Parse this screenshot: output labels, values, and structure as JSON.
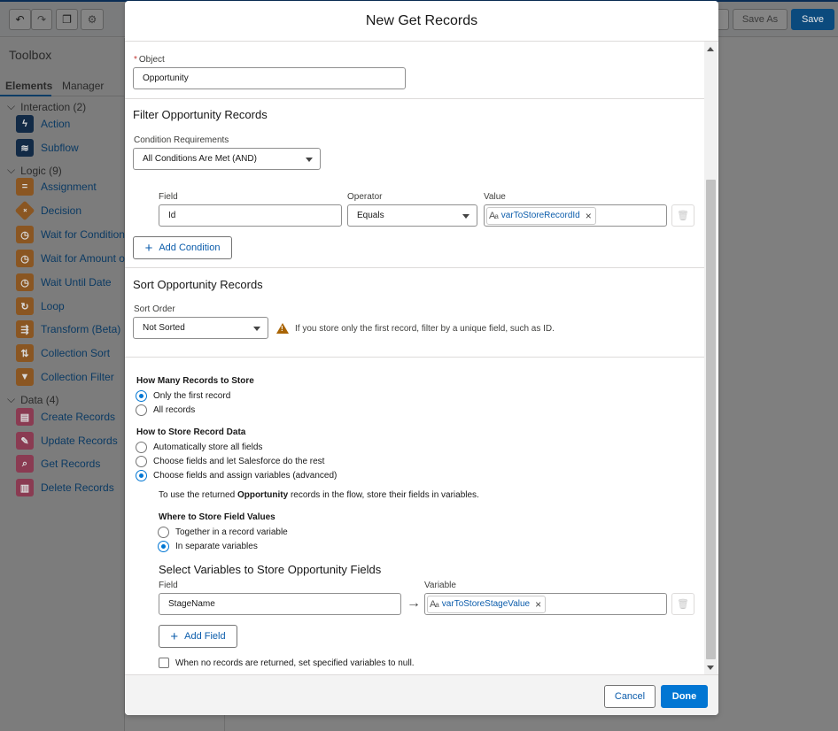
{
  "app": {
    "toolbar": {
      "save_as_label": "Save As",
      "save_label": "Save"
    },
    "toolbox": {
      "title": "Toolbox",
      "tabs": [
        "Elements",
        "Manager"
      ],
      "groups": [
        {
          "label": "Interaction (2)",
          "items": [
            "Action",
            "Subflow"
          ]
        },
        {
          "label": "Logic (9)",
          "items": [
            "Assignment",
            "Decision",
            "Wait for Conditions",
            "Wait for Amount of T",
            "Wait Until Date",
            "Loop",
            "Transform (Beta)",
            "Collection Sort",
            "Collection Filter"
          ]
        },
        {
          "label": "Data (4)",
          "items": [
            "Create Records",
            "Update Records",
            "Get Records",
            "Delete Records"
          ]
        }
      ]
    }
  },
  "modal": {
    "title": "New Get Records",
    "object": {
      "label": "Object",
      "value": "Opportunity"
    },
    "filter": {
      "title": "Filter Opportunity Records",
      "condition_label": "Condition Requirements",
      "condition_value": "All Conditions Are Met (AND)",
      "headers": {
        "field": "Field",
        "operator": "Operator",
        "value": "Value"
      },
      "row": {
        "field": "Id",
        "operator": "Equals",
        "value": "varToStoreRecordId"
      },
      "add_condition": "Add Condition"
    },
    "sort": {
      "title": "Sort Opportunity Records",
      "order_label": "Sort Order",
      "order_value": "Not Sorted",
      "warning": "If you store only the first record, filter by a unique field, such as ID."
    },
    "how_many": {
      "title": "How Many Records to Store",
      "options": [
        "Only the first record",
        "All records"
      ],
      "selected": 0
    },
    "how_store": {
      "title": "How to Store Record Data",
      "options": [
        "Automatically store all fields",
        "Choose fields and let Salesforce do the rest",
        "Choose fields and assign variables (advanced)"
      ],
      "selected": 2,
      "info_pre": "To use the returned ",
      "info_bold": "Opportunity",
      "info_post": " records in the flow, store their fields in variables."
    },
    "where": {
      "title": "Where to Store Field Values",
      "options": [
        "Together in a record variable",
        "In separate variables"
      ],
      "selected": 1
    },
    "select_vars": {
      "title": "Select Variables to Store Opportunity Fields",
      "field_label": "Field",
      "variable_label": "Variable",
      "field_value": "StageName",
      "variable_value": "varToStoreStageValue",
      "add_field": "Add Field",
      "null_checkbox": "When no records are returned, set specified variables to null."
    },
    "footer": {
      "cancel": "Cancel",
      "done": "Done"
    }
  }
}
